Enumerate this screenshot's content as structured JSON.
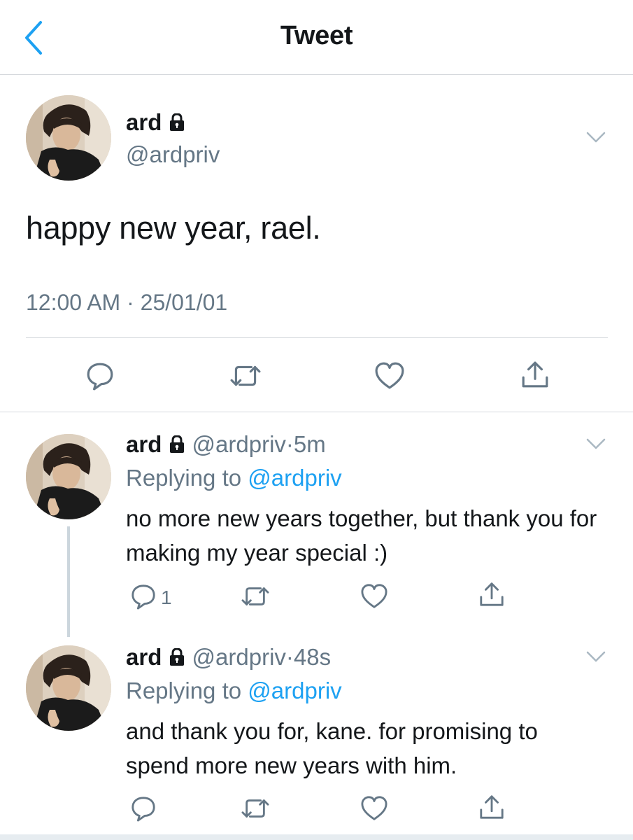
{
  "header": {
    "title": "Tweet",
    "back_icon": "chevron-left-icon",
    "accent": "#1da1f2"
  },
  "main_tweet": {
    "display_name": "ard",
    "handle": "@ardpriv",
    "text": "happy new year, rael.",
    "timestamp": "12:00 AM · 25/01/01",
    "actions": [
      "reply-icon",
      "retweet-icon",
      "like-icon",
      "share-icon"
    ]
  },
  "replies": [
    {
      "display_name": "ard",
      "handle": "@ardpriv",
      "separator": "·",
      "age": "5m",
      "replying_prefix": "Replying to",
      "replying_to": "@ardpriv",
      "text": "no more new years together, but thank you for making my year special :)",
      "reply_count": "1"
    },
    {
      "display_name": "ard",
      "handle": "@ardpriv",
      "separator": "·",
      "age": "48s",
      "replying_prefix": "Replying to",
      "replying_to": "@ardpriv",
      "text": "and thank you for, kane. for promising to spend more new years with him.",
      "reply_count": ""
    }
  ],
  "colors": {
    "text": "#14171a",
    "muted": "#657786",
    "link": "#1da1f2",
    "divider": "#d5d9dd"
  }
}
